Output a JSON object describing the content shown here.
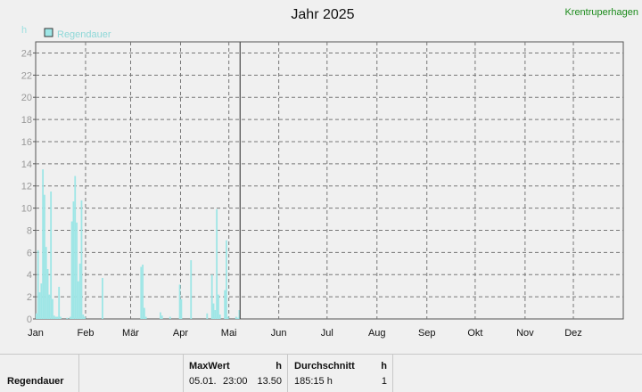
{
  "header": {
    "station": "Krentruperhagen"
  },
  "chart_data": {
    "type": "bar",
    "title": "Jahr 2025",
    "ylabel": "h",
    "ylim": [
      0,
      25
    ],
    "yticks": [
      0,
      2,
      4,
      6,
      8,
      10,
      12,
      14,
      16,
      18,
      20,
      22,
      24
    ],
    "xlim": [
      0,
      365
    ],
    "month_starts": [
      0,
      31,
      59,
      90,
      120,
      151,
      181,
      212,
      243,
      273,
      304,
      334
    ],
    "month_labels": [
      "Jan",
      "Feb",
      "Mär",
      "Apr",
      "Mai",
      "Jun",
      "Jul",
      "Aug",
      "Sep",
      "Okt",
      "Nov",
      "Dez"
    ],
    "grid": true,
    "current_day_marker": 127,
    "legend": {
      "label": "Regendauer",
      "position": "top-left",
      "color": "#9ee6e6"
    },
    "series": [
      {
        "name": "Regendauer",
        "color": "#9ee6e6",
        "values": [
          0.5,
          6.2,
          2.4,
          3.2,
          13.5,
          11.2,
          6.5,
          4.5,
          2.2,
          11.5,
          1.8,
          0.3,
          0.2,
          0.2,
          2.9,
          0.2,
          0,
          0,
          0,
          0.1,
          0,
          0.2,
          8.8,
          10.6,
          12.9,
          8.7,
          3.4,
          5.0,
          10.7,
          0.4,
          0.2,
          0,
          0,
          0,
          0,
          0,
          0,
          0,
          0,
          0,
          0,
          3.7,
          0,
          0,
          0,
          0,
          0,
          0,
          0,
          0,
          0,
          0,
          0,
          0,
          0,
          0,
          0,
          0,
          0,
          0,
          0,
          0,
          0,
          0,
          0,
          4.7,
          4.9,
          1.0,
          0.2,
          0,
          0,
          0,
          0,
          0,
          0,
          0,
          0,
          0.6,
          0.3,
          0,
          0,
          0,
          0,
          0.2,
          0,
          0,
          0,
          0,
          0,
          3.1,
          1.8,
          0,
          0,
          0,
          0,
          0,
          5.3,
          0,
          0,
          0,
          0,
          0,
          0,
          0,
          0,
          0,
          0.5,
          0,
          0,
          4.0,
          1.4,
          0.8,
          9.9,
          2.2,
          0.4,
          0,
          0,
          2.6,
          7.1,
          0.2,
          0,
          0,
          0,
          0,
          0.2,
          0.1,
          0.8
        ]
      }
    ]
  },
  "footer": {
    "row_label": "Regendauer",
    "max": {
      "title": "MaxWert",
      "unit": "h",
      "date": "05.01.",
      "time": "23:00",
      "value": "13.50"
    },
    "avg": {
      "title": "Durchschnitt",
      "unit": "h",
      "value": "185:15 h",
      "count": "1"
    }
  }
}
